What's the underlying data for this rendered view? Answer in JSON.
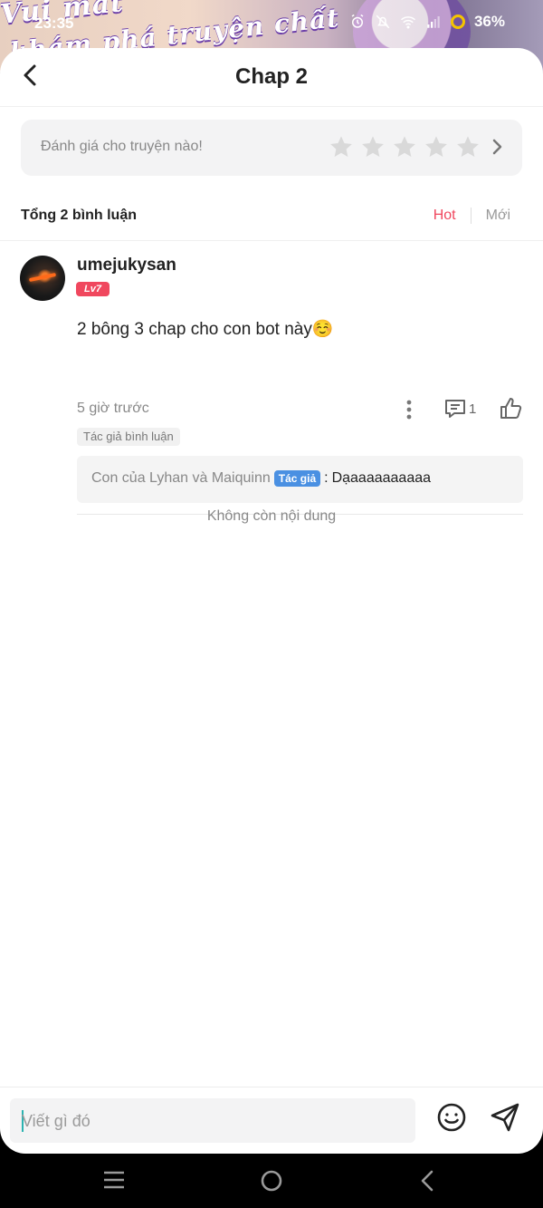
{
  "status_bar": {
    "time": "23:35",
    "battery": "36%",
    "battery_ring_color": "#f4c400"
  },
  "background_banner": {
    "line1": "Vui mắt",
    "line2": "khám phá truyện chất"
  },
  "header": {
    "title": "Chap 2",
    "back_icon": "chevron-left-icon"
  },
  "rating": {
    "placeholder": "Đánh giá cho truyện nào!",
    "stars_total": 5,
    "stars_filled": 0,
    "star_color": "#d9d9d9"
  },
  "comments_section": {
    "summary": "Tổng 2 bình luận",
    "sort_hot": "Hot",
    "sort_new": "Mới",
    "active_sort": "Hot",
    "accent": "#f0475e"
  },
  "comment": {
    "username": "umejukysan",
    "level": "Lv7",
    "text": "2 bông 3 chap cho con bot này☺️",
    "time": "5 giờ trước",
    "reply_count": "1",
    "author_tag": "Tác giả bình luận",
    "reply": {
      "user": "Con của Lyhan và Maiquinn",
      "badge": "Tác giả",
      "separator": ":",
      "text": "Dạaaaaaaaaaa"
    }
  },
  "end_text": "Không còn nội dung",
  "input": {
    "placeholder": "Viết gì đó"
  }
}
